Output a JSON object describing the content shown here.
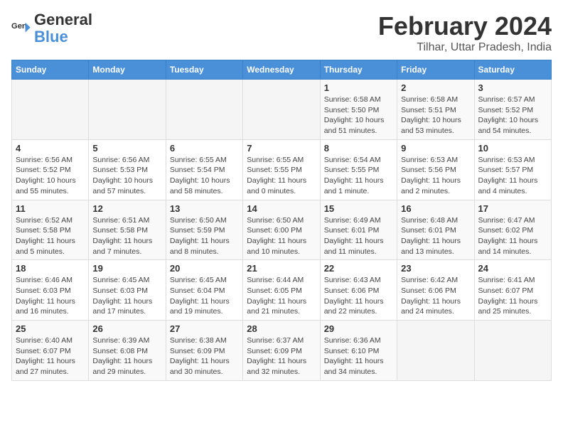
{
  "logo": {
    "text_general": "General",
    "text_blue": "Blue"
  },
  "header": {
    "title": "February 2024",
    "subtitle": "Tilhar, Uttar Pradesh, India"
  },
  "days_of_week": [
    "Sunday",
    "Monday",
    "Tuesday",
    "Wednesday",
    "Thursday",
    "Friday",
    "Saturday"
  ],
  "weeks": [
    [
      {
        "num": "",
        "detail": ""
      },
      {
        "num": "",
        "detail": ""
      },
      {
        "num": "",
        "detail": ""
      },
      {
        "num": "",
        "detail": ""
      },
      {
        "num": "1",
        "detail": "Sunrise: 6:58 AM\nSunset: 5:50 PM\nDaylight: 10 hours\nand 51 minutes."
      },
      {
        "num": "2",
        "detail": "Sunrise: 6:58 AM\nSunset: 5:51 PM\nDaylight: 10 hours\nand 53 minutes."
      },
      {
        "num": "3",
        "detail": "Sunrise: 6:57 AM\nSunset: 5:52 PM\nDaylight: 10 hours\nand 54 minutes."
      }
    ],
    [
      {
        "num": "4",
        "detail": "Sunrise: 6:56 AM\nSunset: 5:52 PM\nDaylight: 10 hours\nand 55 minutes."
      },
      {
        "num": "5",
        "detail": "Sunrise: 6:56 AM\nSunset: 5:53 PM\nDaylight: 10 hours\nand 57 minutes."
      },
      {
        "num": "6",
        "detail": "Sunrise: 6:55 AM\nSunset: 5:54 PM\nDaylight: 10 hours\nand 58 minutes."
      },
      {
        "num": "7",
        "detail": "Sunrise: 6:55 AM\nSunset: 5:55 PM\nDaylight: 11 hours\nand 0 minutes."
      },
      {
        "num": "8",
        "detail": "Sunrise: 6:54 AM\nSunset: 5:55 PM\nDaylight: 11 hours\nand 1 minute."
      },
      {
        "num": "9",
        "detail": "Sunrise: 6:53 AM\nSunset: 5:56 PM\nDaylight: 11 hours\nand 2 minutes."
      },
      {
        "num": "10",
        "detail": "Sunrise: 6:53 AM\nSunset: 5:57 PM\nDaylight: 11 hours\nand 4 minutes."
      }
    ],
    [
      {
        "num": "11",
        "detail": "Sunrise: 6:52 AM\nSunset: 5:58 PM\nDaylight: 11 hours\nand 5 minutes."
      },
      {
        "num": "12",
        "detail": "Sunrise: 6:51 AM\nSunset: 5:58 PM\nDaylight: 11 hours\nand 7 minutes."
      },
      {
        "num": "13",
        "detail": "Sunrise: 6:50 AM\nSunset: 5:59 PM\nDaylight: 11 hours\nand 8 minutes."
      },
      {
        "num": "14",
        "detail": "Sunrise: 6:50 AM\nSunset: 6:00 PM\nDaylight: 11 hours\nand 10 minutes."
      },
      {
        "num": "15",
        "detail": "Sunrise: 6:49 AM\nSunset: 6:01 PM\nDaylight: 11 hours\nand 11 minutes."
      },
      {
        "num": "16",
        "detail": "Sunrise: 6:48 AM\nSunset: 6:01 PM\nDaylight: 11 hours\nand 13 minutes."
      },
      {
        "num": "17",
        "detail": "Sunrise: 6:47 AM\nSunset: 6:02 PM\nDaylight: 11 hours\nand 14 minutes."
      }
    ],
    [
      {
        "num": "18",
        "detail": "Sunrise: 6:46 AM\nSunset: 6:03 PM\nDaylight: 11 hours\nand 16 minutes."
      },
      {
        "num": "19",
        "detail": "Sunrise: 6:45 AM\nSunset: 6:03 PM\nDaylight: 11 hours\nand 17 minutes."
      },
      {
        "num": "20",
        "detail": "Sunrise: 6:45 AM\nSunset: 6:04 PM\nDaylight: 11 hours\nand 19 minutes."
      },
      {
        "num": "21",
        "detail": "Sunrise: 6:44 AM\nSunset: 6:05 PM\nDaylight: 11 hours\nand 21 minutes."
      },
      {
        "num": "22",
        "detail": "Sunrise: 6:43 AM\nSunset: 6:06 PM\nDaylight: 11 hours\nand 22 minutes."
      },
      {
        "num": "23",
        "detail": "Sunrise: 6:42 AM\nSunset: 6:06 PM\nDaylight: 11 hours\nand 24 minutes."
      },
      {
        "num": "24",
        "detail": "Sunrise: 6:41 AM\nSunset: 6:07 PM\nDaylight: 11 hours\nand 25 minutes."
      }
    ],
    [
      {
        "num": "25",
        "detail": "Sunrise: 6:40 AM\nSunset: 6:07 PM\nDaylight: 11 hours\nand 27 minutes."
      },
      {
        "num": "26",
        "detail": "Sunrise: 6:39 AM\nSunset: 6:08 PM\nDaylight: 11 hours\nand 29 minutes."
      },
      {
        "num": "27",
        "detail": "Sunrise: 6:38 AM\nSunset: 6:09 PM\nDaylight: 11 hours\nand 30 minutes."
      },
      {
        "num": "28",
        "detail": "Sunrise: 6:37 AM\nSunset: 6:09 PM\nDaylight: 11 hours\nand 32 minutes."
      },
      {
        "num": "29",
        "detail": "Sunrise: 6:36 AM\nSunset: 6:10 PM\nDaylight: 11 hours\nand 34 minutes."
      },
      {
        "num": "",
        "detail": ""
      },
      {
        "num": "",
        "detail": ""
      }
    ]
  ]
}
